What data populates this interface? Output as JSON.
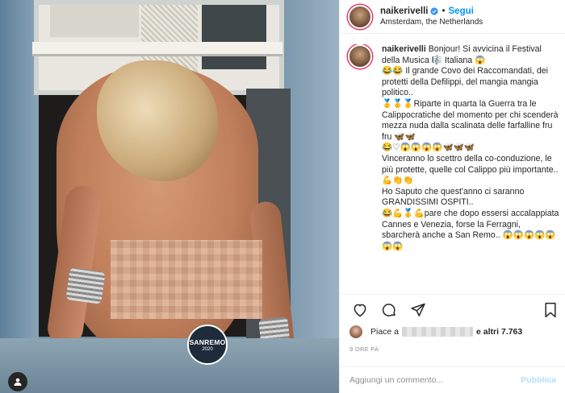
{
  "header": {
    "username": "naikerivelli",
    "separator": "•",
    "follow_label": "Segui",
    "location": "Amsterdam, the Netherlands"
  },
  "caption": {
    "username": "naikerivelli",
    "text": "Bonjour! Si avvicina il Festival della Musica 🎼 Italiana 😱\n😂😂 Il grande Covo dei Raccomandati, dei protetti della Defilippi, del mangia mangia politico..\n🥇🥇🥇Riparte in quarta la Guerra tra le Calippocratiche del momento per chi scenderà mezza nuda dalla scalinata delle farfalline fru fru 🦋🦋\n😂♡😱😱😱😱🦋🦋🦋\nVinceranno lo scettro della co-conduzione, le più protette, quelle col Calippo più importante.. 💪👏👏\nHo Saputo che quest'anno ci saranno GRANDISSIMI OSPITI..\n😂💪🥇💪pare che dopo essersi accalappiata Cannes e Venezia, forse la Ferragni, sbarcherà anche a San Remo.. 😱😱😱😱😱😱😱"
  },
  "photo": {
    "badge_title": "SANREMO",
    "badge_year": "2020"
  },
  "likes": {
    "prefix": "Piace a",
    "suffix": "e altri 7.763"
  },
  "timestamp": "9 ORE FA",
  "comment": {
    "placeholder": "Aggiungi un commento...",
    "publish_label": "Pubblica"
  },
  "colors": {
    "accent": "#0095f6",
    "publish_disabled": "#b2dffc",
    "verified": "#3897f0"
  },
  "icons": {
    "like": "heart-icon",
    "comment": "comment-icon",
    "share": "paper-plane-icon",
    "save": "bookmark-icon",
    "verified": "verified-badge-icon",
    "user_tag": "user-tag-icon"
  }
}
